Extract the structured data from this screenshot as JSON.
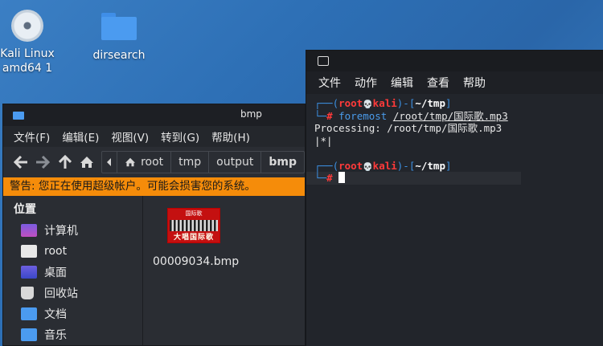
{
  "desktop": {
    "icons": [
      {
        "label": "Kali Linux amd64 1"
      },
      {
        "label": "dirsearch"
      }
    ]
  },
  "terminal": {
    "menu": [
      "文件",
      "动作",
      "编辑",
      "查看",
      "帮助"
    ],
    "prompt": {
      "user": "root",
      "skull": "💀",
      "host": "kali",
      "path": "~/tmp",
      "hash": "#"
    },
    "command": "foremost",
    "command_arg": "/root/tmp/国际歌.mp3",
    "output_line": "Processing: /root/tmp/国际歌.mp3",
    "progress_line": "|*|"
  },
  "file_manager": {
    "title": "bmp",
    "menu": [
      "文件(F)",
      "编辑(E)",
      "视图(V)",
      "转到(G)",
      "帮助(H)"
    ],
    "breadcrumb": [
      "root",
      "tmp",
      "output",
      "bmp"
    ],
    "warning": "警告: 您正在使用超级帐户。可能会损害您的系统。",
    "sidebar_heading": "位置",
    "sidebar_items": [
      {
        "label": "计算机",
        "color": "#7a5ce0"
      },
      {
        "label": "root",
        "color": "#e8e8e8"
      },
      {
        "label": "桌面",
        "color": "#6d5fe0"
      },
      {
        "label": "回收站",
        "color": "#d8d8d8"
      },
      {
        "label": "文档",
        "color": "#4b9bf0"
      },
      {
        "label": "音乐",
        "color": "#4b9bf0"
      }
    ],
    "file": {
      "name": "00009034.bmp",
      "thumb_top": "国际歌",
      "thumb_caption": "大唱国际歌"
    }
  }
}
